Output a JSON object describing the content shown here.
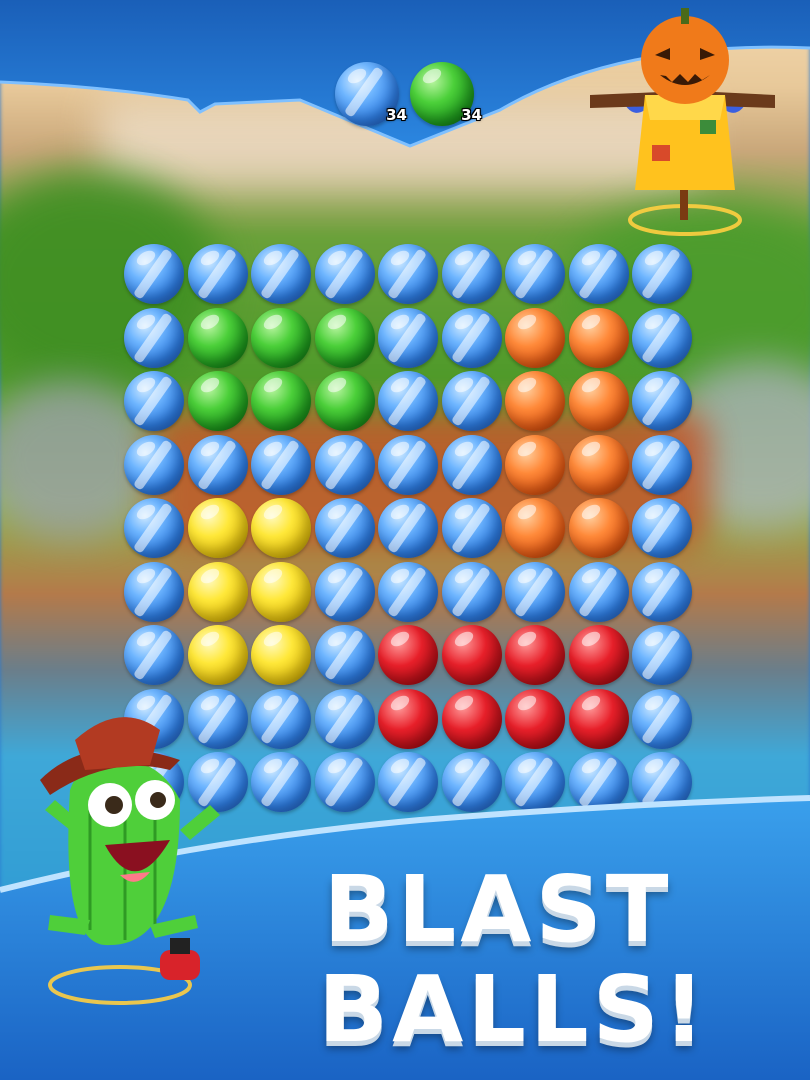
{
  "top": {
    "targets": [
      {
        "color": "blue",
        "count": "34",
        "icon": "blue-ball-icon"
      },
      {
        "color": "green",
        "count": "34",
        "icon": "green-ball-icon"
      }
    ]
  },
  "board": {
    "rows": [
      [
        "blue",
        "blue",
        "blue",
        "blue",
        "blue",
        "blue",
        "blue",
        "blue",
        "blue"
      ],
      [
        "blue",
        "green",
        "green",
        "green",
        "blue",
        "blue",
        "orange",
        "orange",
        "blue"
      ],
      [
        "blue",
        "green",
        "green",
        "green",
        "blue",
        "blue",
        "orange",
        "orange",
        "blue"
      ],
      [
        "blue",
        "blue",
        "blue",
        "blue",
        "blue",
        "blue",
        "orange",
        "orange",
        "blue"
      ],
      [
        "blue",
        "yellow",
        "yellow",
        "blue",
        "blue",
        "blue",
        "orange",
        "orange",
        "blue"
      ],
      [
        "blue",
        "yellow",
        "yellow",
        "blue",
        "blue",
        "blue",
        "blue",
        "blue",
        "blue"
      ],
      [
        "blue",
        "yellow",
        "yellow",
        "blue",
        "red",
        "red",
        "red",
        "red",
        "blue"
      ],
      [
        "blue",
        "blue",
        "blue",
        "blue",
        "red",
        "red",
        "red",
        "red",
        "blue"
      ],
      [
        "blue",
        "blue",
        "blue",
        "blue",
        "blue",
        "blue",
        "blue",
        "blue",
        "blue"
      ]
    ]
  },
  "headline": {
    "line1": "BLAST",
    "line2": "BALLS!"
  },
  "characters": {
    "opponent": "pumpkin-scarecrow",
    "player": "cactus-cowboy"
  },
  "colors": {
    "blue": "#2f7fe6",
    "green": "#1e9a1d",
    "orange": "#e65a14",
    "yellow": "#e7c40f",
    "red": "#b80e16",
    "banner": "#1f74d2"
  }
}
